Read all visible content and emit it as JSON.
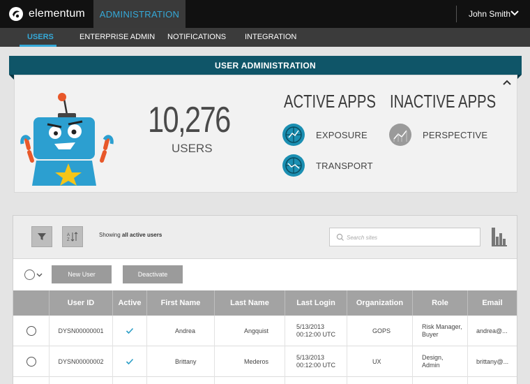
{
  "app": {
    "brand": "elementum",
    "active_tab": "ADMINISTRATION",
    "user_name": "John Smith"
  },
  "subnav": {
    "items": [
      "USERS",
      "ENTERPRISE ADMIN",
      "NOTIFICATIONS",
      "INTEGRATION"
    ],
    "active": "USERS"
  },
  "summary": {
    "title": "USER ADMINISTRATION",
    "user_count": "10,276",
    "user_count_label": "USERS",
    "active_apps_title": "ACTIVE APPS",
    "inactive_apps_title": "INACTIVE APPS",
    "active_apps": [
      "EXPOSURE",
      "TRANSPORT"
    ],
    "inactive_apps": [
      "PERSPECTIVE"
    ]
  },
  "toolbar": {
    "showing_prefix": "Showing",
    "showing_filter": "all active users",
    "search_placeholder": "Search sites",
    "new_user_label": "New User",
    "deactivate_label": "Deactivate"
  },
  "table": {
    "columns": [
      "",
      "User ID",
      "Active",
      "First Name",
      "Last Name",
      "Last Login",
      "Organization",
      "Role",
      "Email"
    ],
    "rows": [
      {
        "user_id": "DYSN00000001",
        "active": true,
        "first_name": "Andrea",
        "last_name": "Angquist",
        "last_login": "5/13/2013\n00:12:00 UTC",
        "organization": "GOPS",
        "role": "Risk Manager,\nBuyer",
        "email": "andrea@..."
      },
      {
        "user_id": "DYSN00000002",
        "active": true,
        "first_name": "Brittany",
        "last_name": "Mederos",
        "last_login": "5/13/2013\n00:12:00 UTC",
        "organization": "UX",
        "role": "Design,\nAdmin",
        "email": "brittany@..."
      }
    ]
  },
  "colors": {
    "accent": "#35a9d8",
    "band": "#0f5568",
    "header_bg": "#111111",
    "subnav_bg": "#3b3b3b",
    "table_head": "#a3a3a3",
    "app_icon": "#1b8fb2"
  }
}
